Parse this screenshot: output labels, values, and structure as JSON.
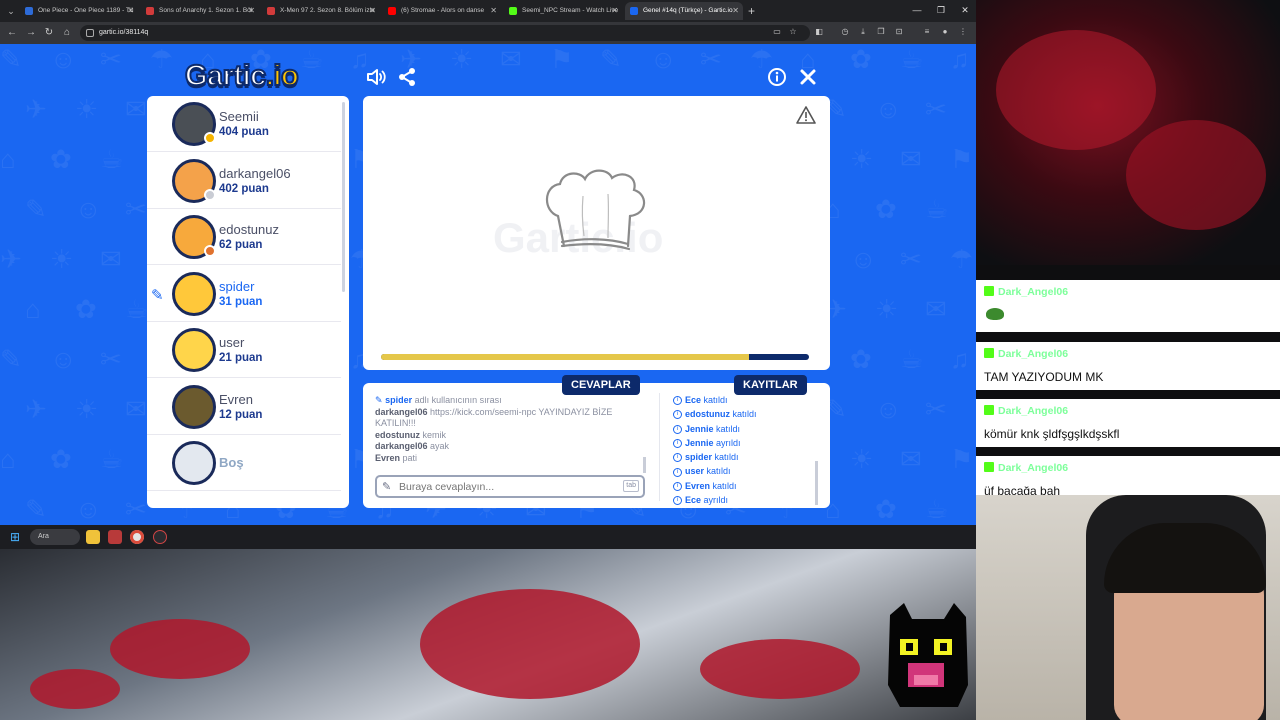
{
  "browser": {
    "tabs": [
      {
        "title": "One Piece - One Piece 1189 - Tü",
        "favicon_color": "#2d6bd8",
        "active": false
      },
      {
        "title": "Sons of Anarchy 1. Sezon 1. Böl",
        "favicon_color": "#d23b3b",
        "active": false
      },
      {
        "title": "X-Men 97 2. Sezon 8. Bölüm izle",
        "favicon_color": "#d23b3b",
        "active": false
      },
      {
        "title": "(6) Stromae - Alors on danse",
        "favicon_color": "#ff0000",
        "active": false
      },
      {
        "title": "Seemi_NPC Stream - Watch Live",
        "favicon_color": "#53fc18",
        "active": false
      },
      {
        "title": "Genel #14q (Türkçe) - Gartic.io",
        "favicon_color": "#1a67f2",
        "active": true
      }
    ],
    "new_tab": "+",
    "url": "gartic.io/38114q",
    "window_controls": {
      "minimize": "—",
      "maximize": "❐",
      "close": "✕"
    }
  },
  "game": {
    "logo": {
      "part1": "Gartic",
      "part2": ".io"
    },
    "players": [
      {
        "name": "Seemii",
        "score": "404 puan",
        "avatar_color": "#4a4f55",
        "status_color": "#f5b400",
        "drawing": false
      },
      {
        "name": "darkangel06",
        "score": "402 puan",
        "avatar_color": "#f4a24a",
        "status_color": "#c9ccd4",
        "drawing": false
      },
      {
        "name": "edostunuz",
        "score": "62 puan",
        "avatar_color": "#f7a93c",
        "status_color": "#e0722e",
        "drawing": false
      },
      {
        "name": "spider",
        "score": "31 puan",
        "avatar_color": "#ffc83a",
        "status_color": "",
        "drawing": true
      },
      {
        "name": "user",
        "score": "21 puan",
        "avatar_color": "#ffd54a",
        "status_color": "",
        "drawing": false
      },
      {
        "name": "Evren",
        "score": "12 puan",
        "avatar_color": "#6b5a2e",
        "status_color": "",
        "drawing": false
      },
      {
        "name": "Boş",
        "score": "",
        "avatar_color": "#e3e8ef",
        "status_color": "",
        "drawing": false
      }
    ],
    "canvas": {
      "watermark": "Gartic.io",
      "progress": 0.86
    },
    "answers": {
      "tab_label": "CEVAPLAR",
      "messages": [
        {
          "user": "spider",
          "text": "adlı kullanıcının sırası",
          "system": true
        },
        {
          "user": "darkangel06",
          "text": "https://kick.com/seemi-npc YAYINDAYIZ BİZE KATILIN!!!",
          "system": false
        },
        {
          "user": "edostunuz",
          "text": "kemik",
          "system": false
        },
        {
          "user": "darkangel06",
          "text": "ayak",
          "system": false
        },
        {
          "user": "Evren",
          "text": "pati",
          "system": false
        }
      ],
      "input_placeholder": "Buraya cevaplayın...",
      "tab_hint": "tab"
    },
    "logs": {
      "tab_label": "KAYITLAR",
      "entries": [
        {
          "user": "Ece",
          "action": "katıldı"
        },
        {
          "user": "edostunuz",
          "action": "katıldı"
        },
        {
          "user": "Jennie",
          "action": "katıldı"
        },
        {
          "user": "Jennie",
          "action": "ayrıldı"
        },
        {
          "user": "spider",
          "action": "katıldı"
        },
        {
          "user": "user",
          "action": "katıldı"
        },
        {
          "user": "Evren",
          "action": "katıldı"
        },
        {
          "user": "Ece",
          "action": "ayrıldı"
        }
      ]
    }
  },
  "taskbar": {
    "search_label": "Ara"
  },
  "stream_chat": [
    {
      "user": "Dark_Angel06",
      "text": "",
      "emote": true
    },
    {
      "user": "Dark_Angel06",
      "text": "TAM YAZIYODUM MK",
      "emote": false
    },
    {
      "user": "Dark_Angel06",
      "text": "kömür knk şldfşgşlkdşskfl",
      "emote": false
    },
    {
      "user": "Dark_Angel06",
      "text": "üf bacağa bah",
      "emote": false
    }
  ]
}
